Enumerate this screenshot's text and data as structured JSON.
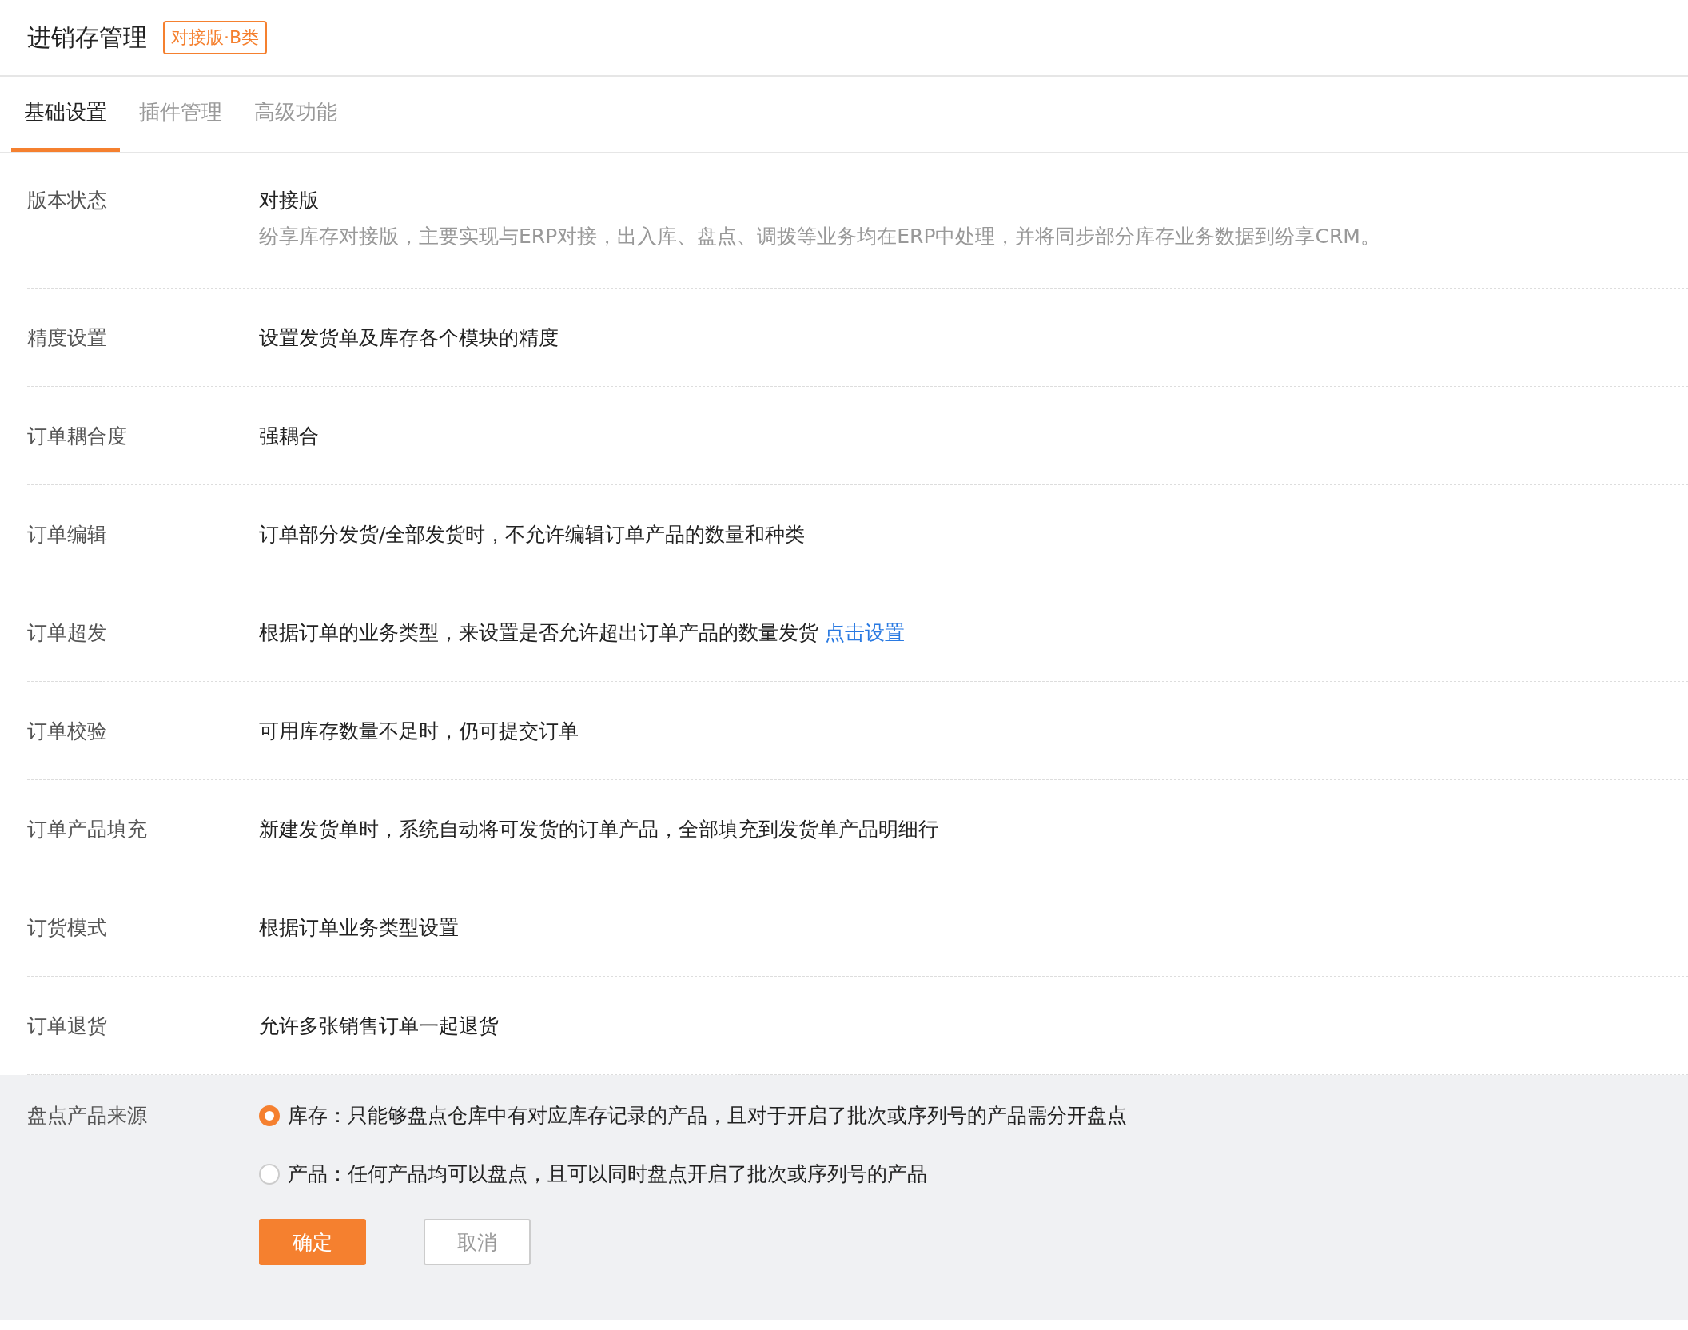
{
  "header": {
    "title": "进销存管理",
    "badge": "对接版·B类"
  },
  "tabs": [
    {
      "label": "基础设置",
      "selected": true
    },
    {
      "label": "插件管理",
      "selected": false
    },
    {
      "label": "高级功能",
      "selected": false
    }
  ],
  "settings": [
    {
      "label": "版本状态",
      "value": "对接版",
      "description": "纷享库存对接版，主要实现与ERP对接，出入库、盘点、调拨等业务均在ERP中处理，并将同步部分库存业务数据到纷享CRM。"
    },
    {
      "label": "精度设置",
      "value": "设置发货单及库存各个模块的精度"
    },
    {
      "label": "订单耦合度",
      "value": "强耦合"
    },
    {
      "label": "订单编辑",
      "value": "订单部分发货/全部发货时，不允许编辑订单产品的数量和种类"
    },
    {
      "label": "订单超发",
      "value": "根据订单的业务类型，来设置是否允许超出订单产品的数量发货",
      "link": "点击设置"
    },
    {
      "label": "订单校验",
      "value": "可用库存数量不足时，仍可提交订单"
    },
    {
      "label": "订单产品填充",
      "value": "新建发货单时，系统自动将可发货的订单产品，全部填充到发货单产品明细行"
    },
    {
      "label": "订货模式",
      "value": "根据订单业务类型设置"
    },
    {
      "label": "订单退货",
      "value": "允许多张销售订单一起退货"
    }
  ],
  "edit_panel": {
    "label": "盘点产品来源",
    "options": [
      {
        "label": "库存：只能够盘点仓库中有对应库存记录的产品，且对于开启了批次或序列号的产品需分开盘点",
        "selected": true
      },
      {
        "label": "产品：任何产品均可以盘点，且可以同时盘点开启了批次或序列号的产品",
        "selected": false
      }
    ],
    "buttons": [
      {
        "label": "确定",
        "kind": "primary"
      },
      {
        "label": "取消",
        "kind": "secondary"
      }
    ]
  }
}
